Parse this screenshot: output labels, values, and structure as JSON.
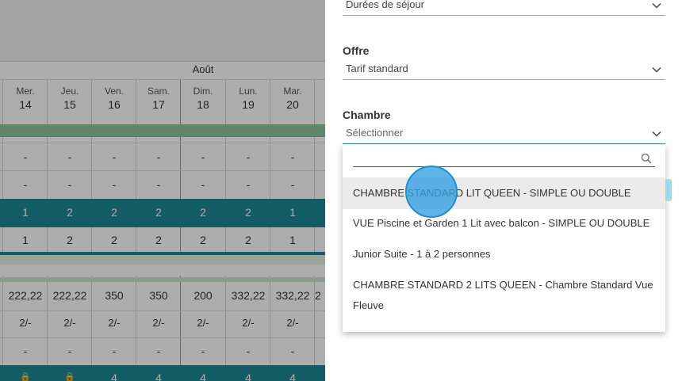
{
  "calendar": {
    "month": "Août",
    "days": [
      {
        "name": "Mer.",
        "num": "14"
      },
      {
        "name": "Jeu.",
        "num": "15"
      },
      {
        "name": "Ven.",
        "num": "16"
      },
      {
        "name": "Sam.",
        "num": "17"
      },
      {
        "name": "Dim.",
        "num": "18"
      },
      {
        "name": "Lun.",
        "num": "19"
      },
      {
        "name": "Mar.",
        "num": "20"
      }
    ],
    "rows": {
      "dash_a": [
        "-",
        "-",
        "-",
        "-",
        "-",
        "-",
        "-"
      ],
      "dash_b": [
        "-",
        "-",
        "-",
        "-",
        "-",
        "-",
        "-"
      ],
      "availability": [
        "1",
        "2",
        "2",
        "2",
        "2",
        "2",
        "1"
      ],
      "count": [
        "1",
        "2",
        "2",
        "2",
        "2",
        "2",
        "1"
      ],
      "prices": [
        "222,22",
        "222,22",
        "350",
        "350",
        "200",
        "332,22",
        "332,22"
      ],
      "prices_next": "2",
      "min_stay": [
        "2/-",
        "2/-",
        "2/-",
        "2/-",
        "2/-",
        "2/-",
        "2/-"
      ],
      "dash_c": [
        "-",
        "-",
        "-",
        "-",
        "-",
        "-",
        "-"
      ],
      "bottom": [
        "🔒",
        "🔒",
        "4",
        "4",
        "4",
        "4",
        "4"
      ]
    },
    "colors": {
      "teal": "#1d8796",
      "green": "#8fc59a",
      "light_green": "#cfe5d2"
    }
  },
  "panel": {
    "duree": {
      "value": "Durées de séjour"
    },
    "offre": {
      "label": "Offre",
      "value": "Tarif standard"
    },
    "chambre": {
      "label": "Chambre",
      "placeholder": "Sélectionner"
    },
    "dropdown": {
      "search_placeholder": "",
      "options": [
        "CHAMBRE STANDARD LIT QUEEN - SIMPLE OU DOUBLE",
        "VUE Piscine et Garden 1 Lit avec balcon - SIMPLE OU DOUBLE",
        "Junior Suite - 1 à 2 personnes",
        "CHAMBRE STANDARD 2 LITS QUEEN - Chambre Standard Vue",
        "Fleuve"
      ],
      "highlighted_index": 0
    },
    "icons": {
      "chevron": "chevron-down-icon",
      "search": "search-icon"
    }
  }
}
